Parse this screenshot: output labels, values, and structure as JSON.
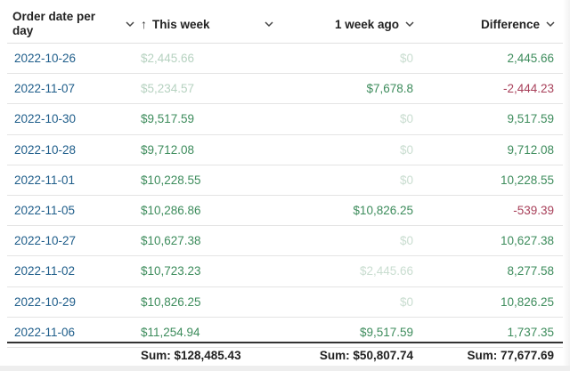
{
  "table": {
    "columns": {
      "date": "Order date per day",
      "this_week": "This week",
      "week_ago": "1 week ago",
      "difference": "Difference"
    },
    "sort_arrow": "↑",
    "rows": [
      {
        "date": "2022-10-26",
        "this_week": "$2,445.66",
        "week_ago": "$0",
        "difference": "2,445.66"
      },
      {
        "date": "2022-11-07",
        "this_week": "$5,234.57",
        "week_ago": "$7,678.8",
        "difference": "-2,444.23"
      },
      {
        "date": "2022-10-30",
        "this_week": "$9,517.59",
        "week_ago": "$0",
        "difference": "9,517.59"
      },
      {
        "date": "2022-10-28",
        "this_week": "$9,712.08",
        "week_ago": "$0",
        "difference": "9,712.08"
      },
      {
        "date": "2022-11-01",
        "this_week": "$10,228.55",
        "week_ago": "$0",
        "difference": "10,228.55"
      },
      {
        "date": "2022-11-05",
        "this_week": "$10,286.86",
        "week_ago": "$10,826.25",
        "difference": "-539.39"
      },
      {
        "date": "2022-10-27",
        "this_week": "$10,627.38",
        "week_ago": "$0",
        "difference": "10,627.38"
      },
      {
        "date": "2022-11-02",
        "this_week": "$10,723.23",
        "week_ago": "$2,445.66",
        "difference": "8,277.58"
      },
      {
        "date": "2022-10-29",
        "this_week": "$10,826.25",
        "week_ago": "$0",
        "difference": "10,826.25"
      },
      {
        "date": "2022-11-06",
        "this_week": "$11,254.94",
        "week_ago": "$9,517.59",
        "difference": "1,737.35"
      }
    ],
    "footer": {
      "this_week": "Sum: $128,485.43",
      "week_ago": "Sum: $50,807.74",
      "difference": "Sum: 77,677.69"
    }
  },
  "colors": {
    "positive": "#3d8c5c",
    "negative": "#a8405a",
    "date_link": "#1e5d8a"
  }
}
